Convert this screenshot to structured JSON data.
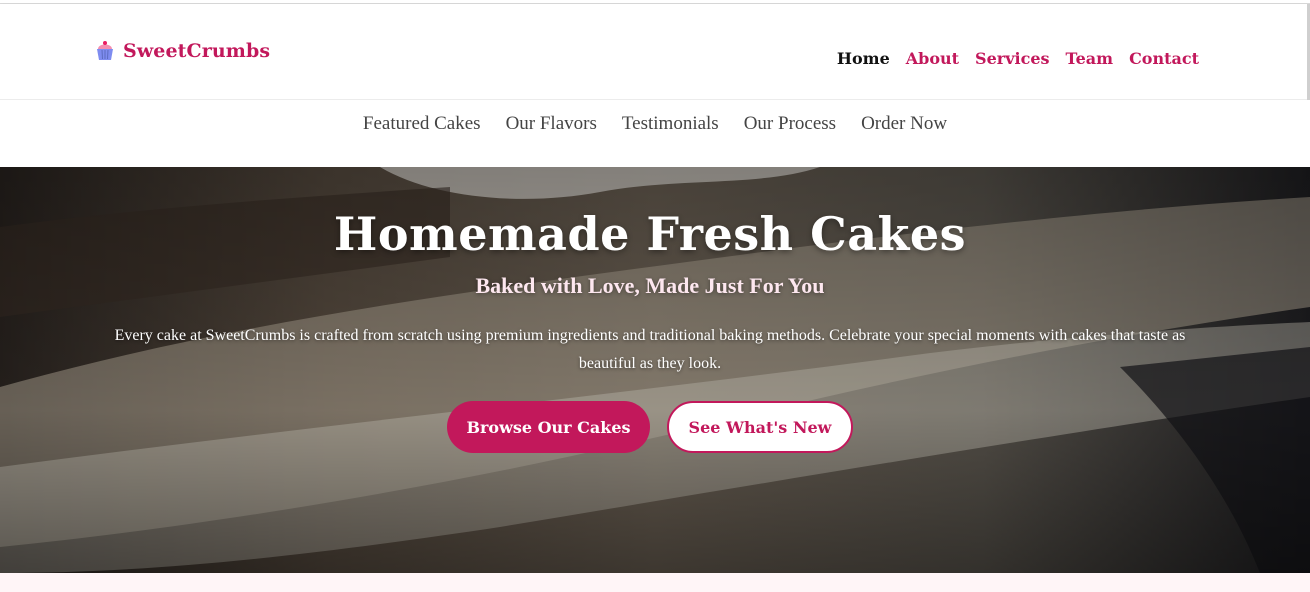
{
  "brand": {
    "name": "SweetCrumbs",
    "icon": "cupcake-icon"
  },
  "main_nav": {
    "items": [
      {
        "label": "Home",
        "active": true
      },
      {
        "label": "About",
        "active": false
      },
      {
        "label": "Services",
        "active": false
      },
      {
        "label": "Team",
        "active": false
      },
      {
        "label": "Contact",
        "active": false
      }
    ]
  },
  "sub_nav": {
    "items": [
      {
        "label": "Featured Cakes"
      },
      {
        "label": "Our Flavors"
      },
      {
        "label": "Testimonials"
      },
      {
        "label": "Our Process"
      },
      {
        "label": "Order Now"
      }
    ]
  },
  "hero": {
    "title": "Homemade Fresh Cakes",
    "subtitle": "Baked with Love, Made Just For You",
    "description": "Every cake at SweetCrumbs is crafted from scratch using premium ingredients and traditional baking methods. Celebrate your special moments with cakes that taste as beautiful as they look.",
    "primary_button": "Browse Our Cakes",
    "secondary_button": "See What's New"
  },
  "colors": {
    "accent": "#c2185b",
    "active_nav": "#111111",
    "sub_nav_text": "#444444",
    "bottom_strip": "#fff5f7"
  }
}
